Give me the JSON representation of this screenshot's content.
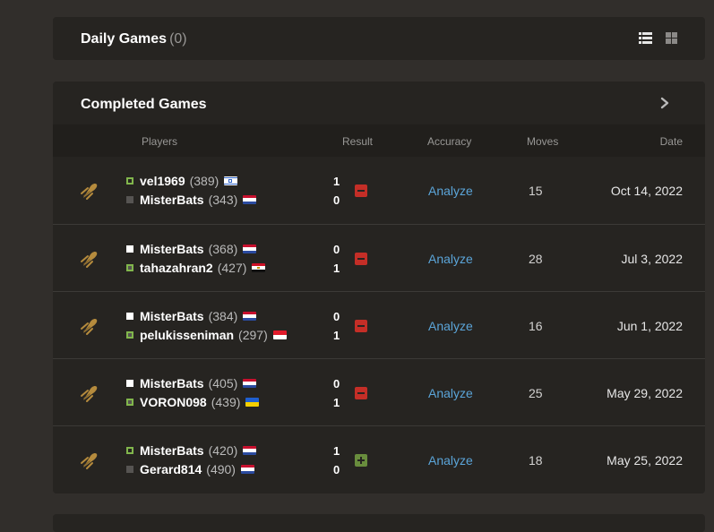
{
  "daily": {
    "title": "Daily Games",
    "count": "(0)"
  },
  "completed": {
    "title": "Completed Games",
    "headers": {
      "players": "Players",
      "result": "Result",
      "accuracy": "Accuracy",
      "moves": "Moves",
      "date": "Date"
    },
    "games": [
      {
        "p1": {
          "name": "vel1969",
          "rating": "(389)",
          "color": "white",
          "winner": true,
          "flag": "israel-flag"
        },
        "p2": {
          "name": "MisterBats",
          "rating": "(343)",
          "color": "black",
          "winner": false,
          "flag": "netherlands-flag"
        },
        "score1": "1",
        "score2": "0",
        "outcome": "loss",
        "analyze": "Analyze",
        "moves": "15",
        "date": "Oct 14, 2022"
      },
      {
        "p1": {
          "name": "MisterBats",
          "rating": "(368)",
          "color": "white",
          "winner": false,
          "flag": "netherlands-flag"
        },
        "p2": {
          "name": "tahazahran2",
          "rating": "(427)",
          "color": "black",
          "winner": true,
          "flag": "egypt-flag"
        },
        "score1": "0",
        "score2": "1",
        "outcome": "loss",
        "analyze": "Analyze",
        "moves": "28",
        "date": "Jul 3, 2022"
      },
      {
        "p1": {
          "name": "MisterBats",
          "rating": "(384)",
          "color": "white",
          "winner": false,
          "flag": "netherlands-flag"
        },
        "p2": {
          "name": "pelukisseniman",
          "rating": "(297)",
          "color": "black",
          "winner": true,
          "flag": "indonesia-flag"
        },
        "score1": "0",
        "score2": "1",
        "outcome": "loss",
        "analyze": "Analyze",
        "moves": "16",
        "date": "Jun 1, 2022"
      },
      {
        "p1": {
          "name": "MisterBats",
          "rating": "(405)",
          "color": "white",
          "winner": false,
          "flag": "netherlands-flag"
        },
        "p2": {
          "name": "VORON098",
          "rating": "(439)",
          "color": "black",
          "winner": true,
          "flag": "ukraine-flag"
        },
        "score1": "0",
        "score2": "1",
        "outcome": "loss",
        "analyze": "Analyze",
        "moves": "25",
        "date": "May 29, 2022"
      },
      {
        "p1": {
          "name": "MisterBats",
          "rating": "(420)",
          "color": "white",
          "winner": true,
          "flag": "netherlands-flag"
        },
        "p2": {
          "name": "Gerard814",
          "rating": "(490)",
          "color": "black",
          "winner": false,
          "flag": "netherlands-flag"
        },
        "score1": "1",
        "score2": "0",
        "outcome": "win",
        "analyze": "Analyze",
        "moves": "18",
        "date": "May 25, 2022"
      }
    ]
  },
  "icons": {
    "list": "list-view-icon",
    "grid": "grid-view-icon",
    "next": "chevron-right-icon",
    "game_type": "bullet-icon"
  },
  "colors": {
    "background": "#312e2b",
    "panel": "#262421",
    "link": "#5ba5d9",
    "loss": "#c42e27",
    "win": "#698d3d",
    "bullet_icon": "#b58b3d"
  }
}
